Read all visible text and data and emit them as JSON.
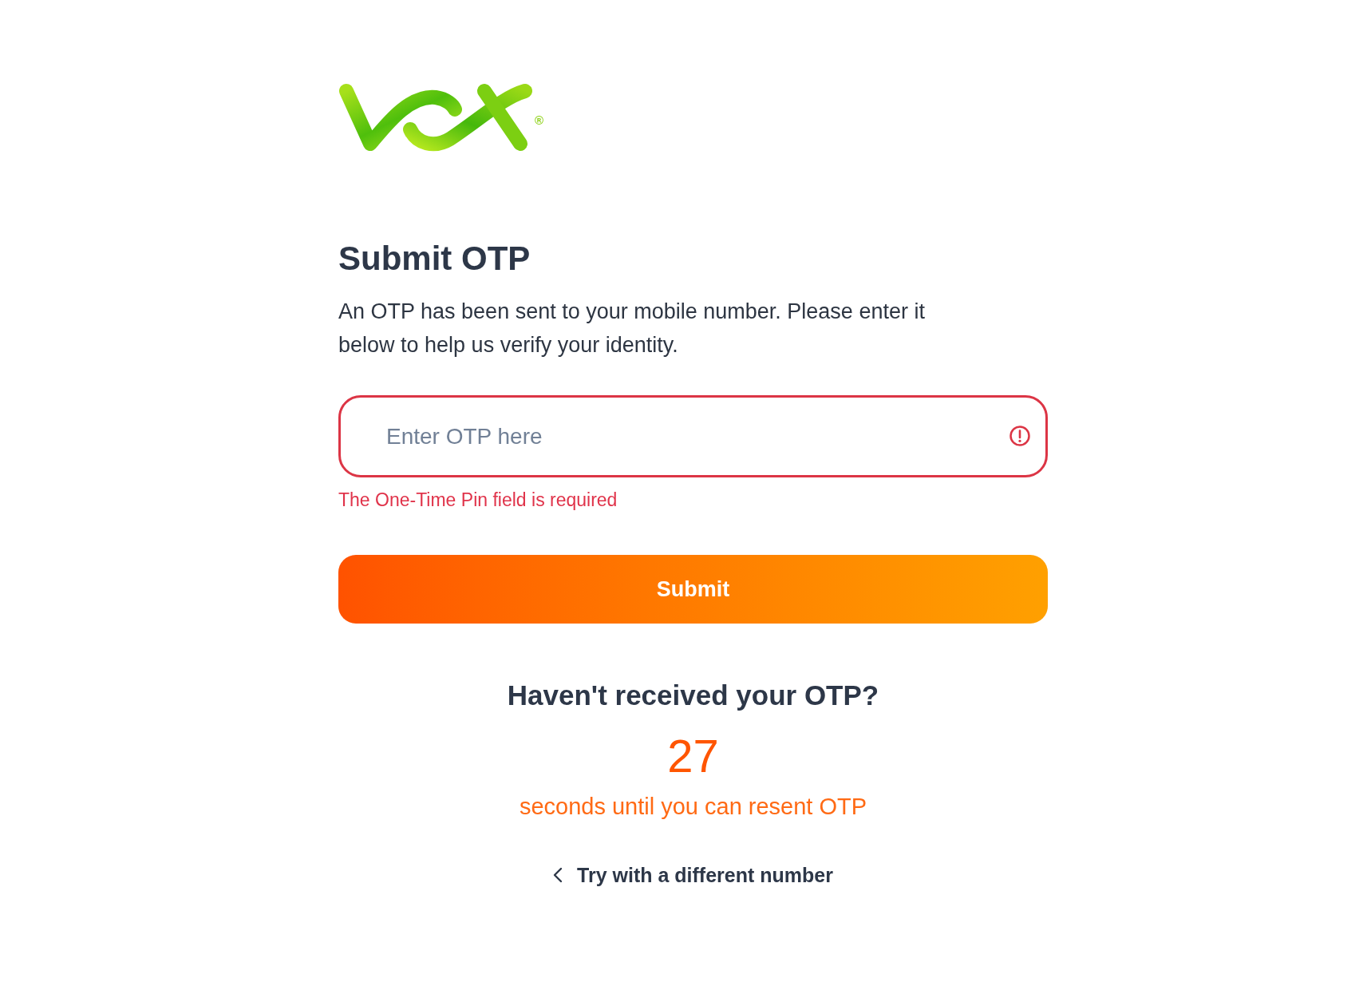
{
  "logo": {
    "registered_mark": "®"
  },
  "title": "Submit OTP",
  "description": "An OTP has been sent to your mobile number. Please enter it below to help us verify your identity.",
  "otp_field": {
    "placeholder": "Enter OTP here",
    "invalid": true,
    "error": "The One-Time Pin field is required"
  },
  "submit_button": {
    "label": "Submit"
  },
  "resend": {
    "title": "Haven't received your OTP?",
    "countdown": "27",
    "caption": "seconds until you can resent OTP"
  },
  "back_link": {
    "label": "Try with a different number"
  }
}
